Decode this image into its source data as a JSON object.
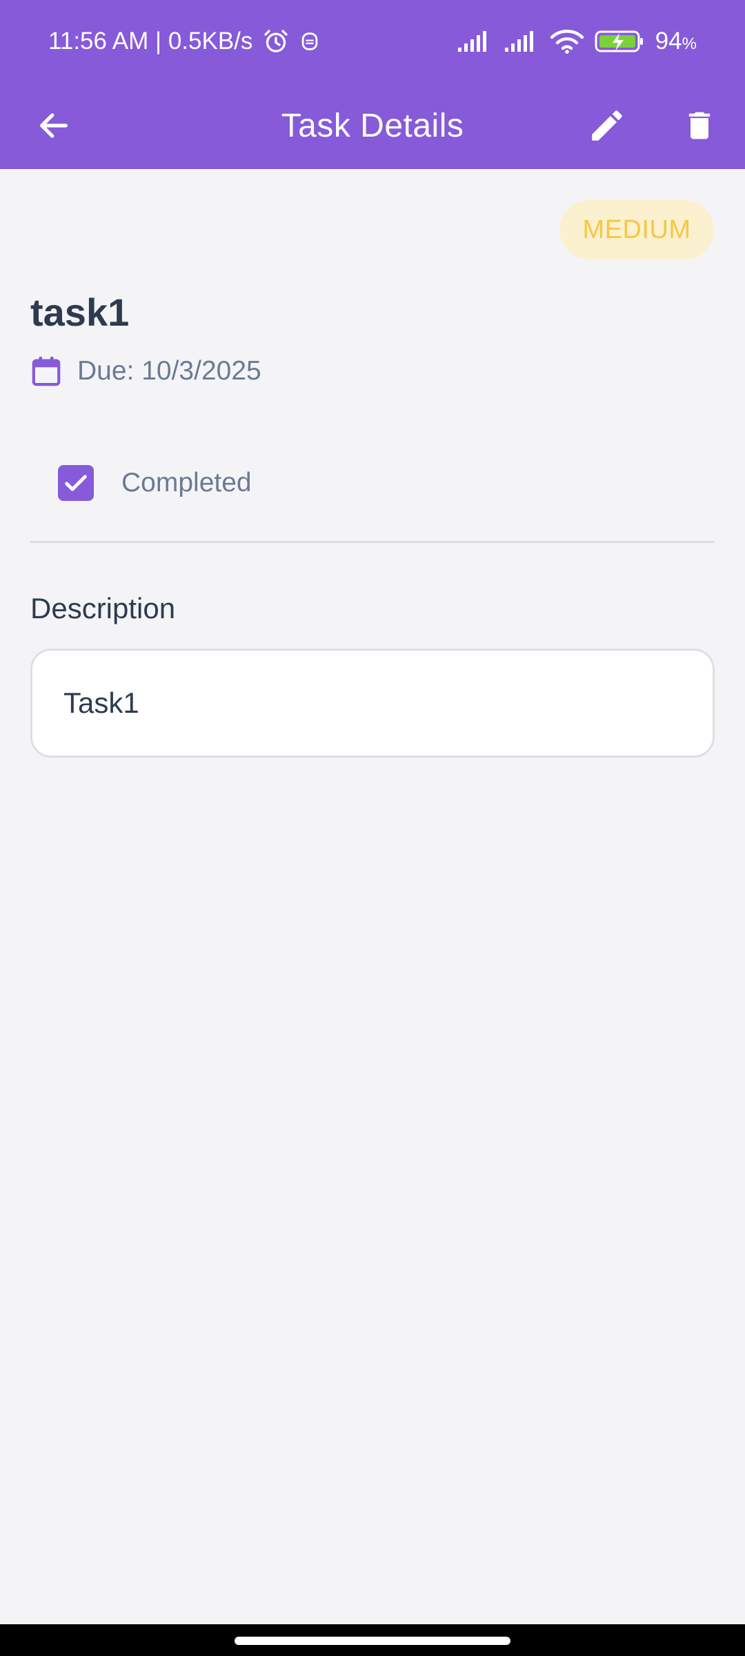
{
  "status_bar": {
    "time_speed": "11:56 AM | 0.5KB/s",
    "battery": "94",
    "battery_unit": "%",
    "icons": [
      "alarm-icon",
      "notification-icon",
      "signal-icon",
      "signal-icon",
      "wifi-icon",
      "battery-charging-icon"
    ]
  },
  "app_bar": {
    "title": "Task Details",
    "back_icon": "arrow-left-icon",
    "edit_icon": "pencil-icon",
    "delete_icon": "trash-icon",
    "background": "#865ad9"
  },
  "task": {
    "priority": "MEDIUM",
    "name": "task1",
    "due": "Due: 10/3/2025",
    "completed_label": "Completed",
    "completed": true,
    "description_label": "Description",
    "description": "Task1"
  },
  "colors": {
    "accent": "#865ad9",
    "priority_text": "#f7c744",
    "priority_bg": "#fbf1cf",
    "heading_text": "#2e3a50",
    "muted_text": "#6b7a93"
  }
}
